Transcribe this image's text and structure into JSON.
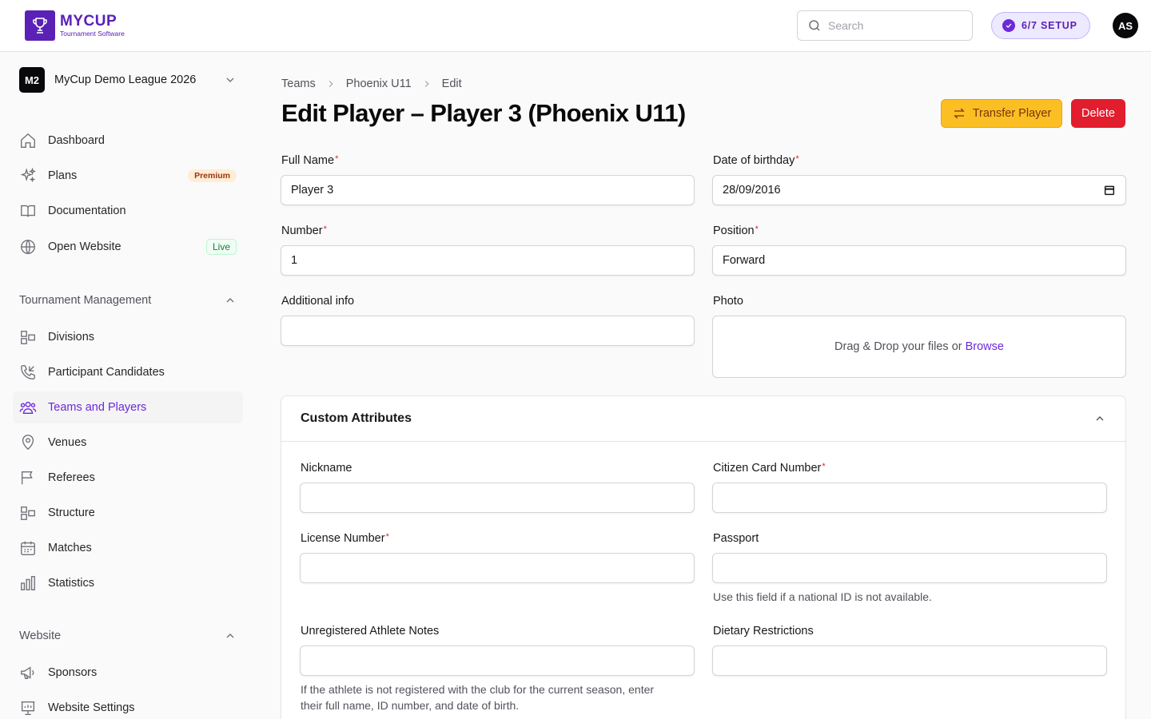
{
  "brand": {
    "title": "MYCUP",
    "subtitle": "Tournament Software"
  },
  "header": {
    "search_placeholder": "Search",
    "setup_label": "6/7 SETUP",
    "avatar_initials": "AS"
  },
  "league": {
    "badge": "M2",
    "name": "MyCup Demo League 2026"
  },
  "nav": {
    "dashboard": "Dashboard",
    "plans": "Plans",
    "plans_badge": "Premium",
    "documentation": "Documentation",
    "open_website": "Open Website",
    "open_website_badge": "Live"
  },
  "sections": {
    "tournament": "Tournament Management",
    "website": "Website"
  },
  "tournament_items": {
    "divisions": "Divisions",
    "candidates": "Participant Candidates",
    "teams": "Teams and Players",
    "venues": "Venues",
    "referees": "Referees",
    "structure": "Structure",
    "matches": "Matches",
    "statistics": "Statistics"
  },
  "website_items": {
    "sponsors": "Sponsors",
    "settings": "Website Settings"
  },
  "breadcrumb": [
    "Teams",
    "Phoenix U11",
    "Edit"
  ],
  "page": {
    "title": "Edit Player – Player 3 (Phoenix U11)",
    "transfer_label": "Transfer Player",
    "delete_label": "Delete"
  },
  "form": {
    "full_name_label": "Full Name",
    "full_name_value": "Player 3",
    "dob_label": "Date of birthday",
    "dob_value": "28/09/2016",
    "number_label": "Number",
    "number_value": "1",
    "position_label": "Position",
    "position_value": "Forward",
    "additional_label": "Additional info",
    "additional_value": "",
    "photo_label": "Photo",
    "dropzone_text": "Drag & Drop your files or",
    "browse_label": "Browse"
  },
  "custom": {
    "title": "Custom Attributes",
    "nickname_label": "Nickname",
    "citizen_label": "Citizen Card Number",
    "license_label": "License Number",
    "passport_label": "Passport",
    "passport_hint": "Use this field if a national ID is not available.",
    "notes_label": "Unregistered Athlete Notes",
    "notes_hint_line1": "If the athlete is not registered with the club for the current season, enter",
    "notes_hint_line2": "their full name, ID number, and date of birth.",
    "dietary_label": "Dietary Restrictions"
  },
  "colors": {
    "accent": "#6d28d9",
    "warning": "#fbbf24",
    "danger": "#e11d2e"
  }
}
